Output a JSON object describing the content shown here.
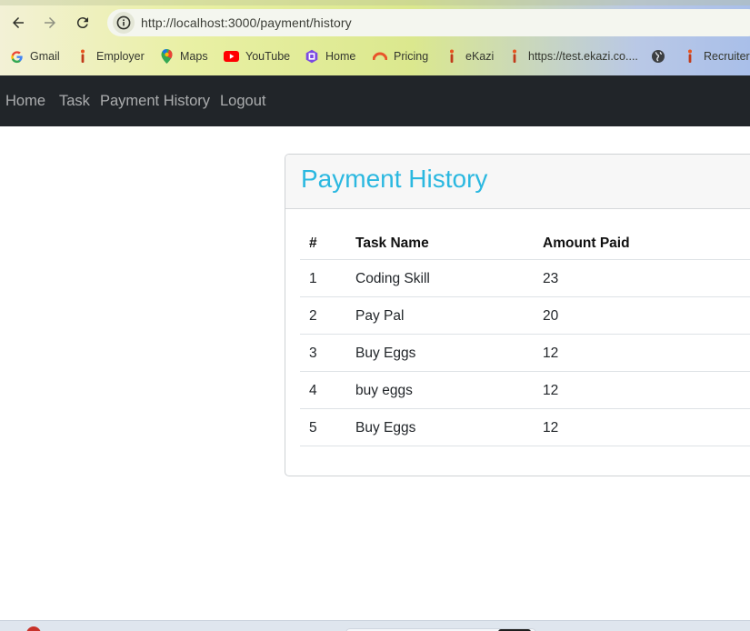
{
  "browser": {
    "url": "http://localhost:3000/payment/history",
    "bookmarks": [
      {
        "label": "Gmail",
        "icon": "google-icon"
      },
      {
        "label": "Employer",
        "icon": "ekazi-icon"
      },
      {
        "label": "Maps",
        "icon": "maps-pin-icon"
      },
      {
        "label": "YouTube",
        "icon": "youtube-icon"
      },
      {
        "label": "Home",
        "icon": "home-hexagon-icon"
      },
      {
        "label": "Pricing",
        "icon": "pricing-arc-icon"
      },
      {
        "label": "eKazi",
        "icon": "ekazi-icon"
      },
      {
        "label": "https://test.ekazi.co....",
        "icon": "ekazi-icon"
      },
      {
        "label": "",
        "icon": "globe-icon"
      },
      {
        "label": "Recruiter",
        "icon": "ekazi-icon"
      }
    ]
  },
  "navbar": {
    "links": [
      "Home",
      "Task",
      "Payment History",
      "Logout"
    ]
  },
  "card": {
    "title": "Payment History",
    "columns": [
      "#",
      "Task Name",
      "Amount Paid"
    ],
    "rows": [
      [
        "1",
        "Coding Skill",
        "23"
      ],
      [
        "2",
        "Pay Pal",
        "20"
      ],
      [
        "3",
        "Buy Eggs",
        "12"
      ],
      [
        "4",
        "buy eggs",
        "12"
      ],
      [
        "5",
        "Buy Eggs",
        "12"
      ]
    ]
  },
  "colors": {
    "navbar_bg": "#212529",
    "title_color": "#2bb8e0"
  }
}
